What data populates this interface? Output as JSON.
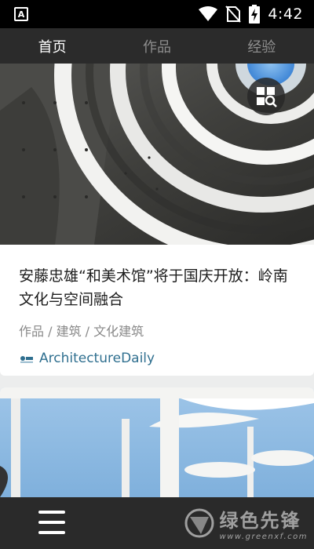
{
  "status_bar": {
    "notification_icon_label": "A",
    "time": "4:42",
    "icons": [
      "wifi-icon",
      "no-sim-icon",
      "battery-charging-icon"
    ]
  },
  "tabs": [
    {
      "label": "首页",
      "active": true
    },
    {
      "label": "作品",
      "active": false
    },
    {
      "label": "经验",
      "active": false
    }
  ],
  "articles": [
    {
      "title": "安藤忠雄“和美术馆”将于国庆开放：岭南文化与空间融合",
      "categories": "作品 / 建筑 / 文化建筑",
      "source": "ArchitectureDaily",
      "image_overlay_icon": "gallery-search-icon"
    }
  ],
  "bottom_bar": {
    "menu_icon": "hamburger-menu-icon",
    "watermark_title": "绿色先锋",
    "watermark_url": "www.greenxf.com"
  },
  "colors": {
    "status_bar_bg": "#000000",
    "tab_bar_bg": "#2b2b2b",
    "tab_active": "#ffffff",
    "tab_inactive": "#8e8e8e",
    "source_link": "#2f6f8f",
    "page_bg": "#eceded"
  }
}
